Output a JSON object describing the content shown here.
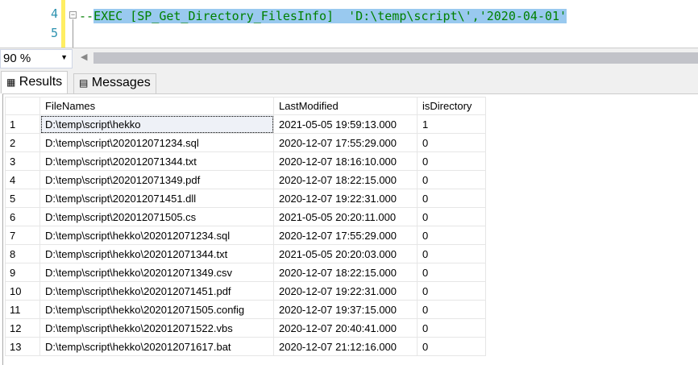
{
  "editor": {
    "lines": [
      {
        "number": "4",
        "code_prefix": "--",
        "code_selected": "EXEC [SP_Get_Directory_FilesInfo]  'D:\\temp\\script\\','2020-04-01'"
      },
      {
        "number": "5",
        "code_prefix": "",
        "code_selected": ""
      }
    ],
    "fold_symbol": "−"
  },
  "zoom": {
    "value": "90 %"
  },
  "tabs": [
    {
      "label": "Results",
      "icon": "grid-icon"
    },
    {
      "label": "Messages",
      "icon": "messages-icon"
    }
  ],
  "grid": {
    "columns": [
      "",
      "FileNames",
      "LastModified",
      "isDirectory"
    ],
    "rows": [
      [
        "1",
        "D:\\temp\\script\\hekko",
        "2021-05-05 19:59:13.000",
        "1"
      ],
      [
        "2",
        "D:\\temp\\script\\202012071234.sql",
        "2020-12-07 17:55:29.000",
        "0"
      ],
      [
        "3",
        "D:\\temp\\script\\202012071344.txt",
        "2020-12-07 18:16:10.000",
        "0"
      ],
      [
        "4",
        "D:\\temp\\script\\202012071349.pdf",
        "2020-12-07 18:22:15.000",
        "0"
      ],
      [
        "5",
        "D:\\temp\\script\\202012071451.dll",
        "2020-12-07 19:22:31.000",
        "0"
      ],
      [
        "6",
        "D:\\temp\\script\\202012071505.cs",
        "2021-05-05 20:20:11.000",
        "0"
      ],
      [
        "7",
        "D:\\temp\\script\\hekko\\202012071234.sql",
        "2020-12-07 17:55:29.000",
        "0"
      ],
      [
        "8",
        "D:\\temp\\script\\hekko\\202012071344.txt",
        "2021-05-05 20:20:03.000",
        "0"
      ],
      [
        "9",
        "D:\\temp\\script\\hekko\\202012071349.csv",
        "2020-12-07 18:22:15.000",
        "0"
      ],
      [
        "10",
        "D:\\temp\\script\\hekko\\202012071451.pdf",
        "2020-12-07 19:22:31.000",
        "0"
      ],
      [
        "11",
        "D:\\temp\\script\\hekko\\202012071505.config",
        "2020-12-07 19:37:15.000",
        "0"
      ],
      [
        "12",
        "D:\\temp\\script\\hekko\\202012071522.vbs",
        "2020-12-07 20:40:41.000",
        "0"
      ],
      [
        "13",
        "D:\\temp\\script\\hekko\\202012071617.bat",
        "2020-12-07 21:12:16.000",
        "0"
      ]
    ]
  }
}
